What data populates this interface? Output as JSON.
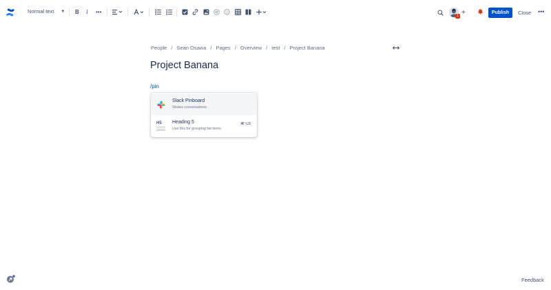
{
  "toolbar": {
    "text_style": "Normal text",
    "publish_label": "Publish",
    "close_label": "Close",
    "more_label": "•••",
    "avatar_badge": "1"
  },
  "breadcrumb": [
    "People",
    "Sean Osawa",
    "Pages",
    "Overview",
    "test",
    "Project Banana"
  ],
  "page": {
    "title": "Project Banana",
    "command_text": "/pin"
  },
  "menu": {
    "items": [
      {
        "title": "Slack Pinboard",
        "description": "Shows conversations",
        "icon": "slack-icon",
        "shortcut": ""
      },
      {
        "title": "Heading 5",
        "description": "Use this for grouping list items",
        "icon": "heading-5-icon",
        "icon_text": "H5",
        "shortcut": "⌘⌥5"
      }
    ]
  },
  "footer": {
    "feedback_label": "Feedback"
  },
  "colors": {
    "primary": "#0052cc",
    "text": "#172b4d",
    "muted": "#6b778c",
    "badge": "#de350b"
  }
}
